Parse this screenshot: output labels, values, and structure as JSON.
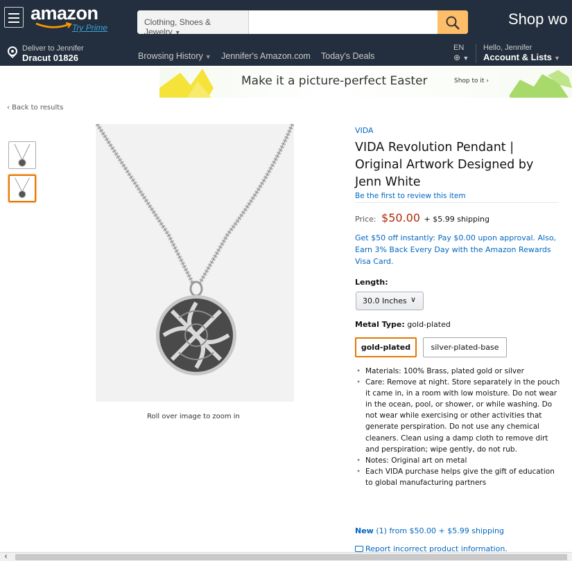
{
  "header": {
    "logo_text": "amazon",
    "logo_prime": "Try Prime",
    "search": {
      "category": "Clothing, Shoes & Jewelry",
      "placeholder": ""
    },
    "promo_text": "Shop wo",
    "deliver_line1": "Deliver to Jennifer",
    "deliver_line2": "Dracut 01826",
    "nav_links": [
      "Browsing History",
      "Jennifer's Amazon.com",
      "Today's Deals"
    ],
    "lang_code": "EN",
    "account_line1": "Hello, Jennifer",
    "account_line2": "Account & Lists"
  },
  "banner": {
    "text": "Make it a picture-perfect Easter",
    "cta": "Shop to it ›"
  },
  "breadcrumb": {
    "back_label": "‹ Back to results"
  },
  "gallery": {
    "thumbnail_count": 2,
    "selected_thumbnail": 2,
    "zoom_hint": "Roll over image to zoom in"
  },
  "product": {
    "brand": "VIDA",
    "title": "VIDA Revolution Pendant | Original Artwork Designed by Jenn White",
    "review_link": "Be the first to review this item",
    "price_label": "Price:",
    "price": "$50.00",
    "shipping": "+ $5.99 shipping",
    "offer": "Get $50 off instantly: Pay $0.00 upon approval. Also, Earn 3% Back Every Day with the Amazon Rewards Visa Card.",
    "length_label": "Length:",
    "length_value": "30.0 Inches",
    "metal_label": "Metal Type:",
    "metal_value": "gold-plated",
    "metal_options": [
      "gold-plated",
      "silver-plated-base"
    ],
    "bullets": [
      "Materials: 100% Brass, plated gold or silver",
      "Care: Remove at night. Store separately in the pouch it came in, in a room with low moisture. Do not wear in the ocean, pool, or shower, or while washing. Do not wear while exercising or other activities that generate perspiration. Do not use any chemical cleaners. Clean using a damp cloth to remove dirt and perspiration; wipe gently, do not rub.",
      "Notes: Original art on metal",
      "Each VIDA purchase helps give the gift of education to global manufacturing partners"
    ],
    "new_offers_label": "New",
    "new_offers_count": "(1)",
    "new_offers_rest": "from $50.00 + $5.99 shipping",
    "report_link": "Report incorrect product information."
  },
  "colors": {
    "nav_bg": "#232f3e",
    "search_button": "#febd69",
    "price": "#b12704",
    "link": "#0066c0",
    "selection": "#e77600"
  }
}
